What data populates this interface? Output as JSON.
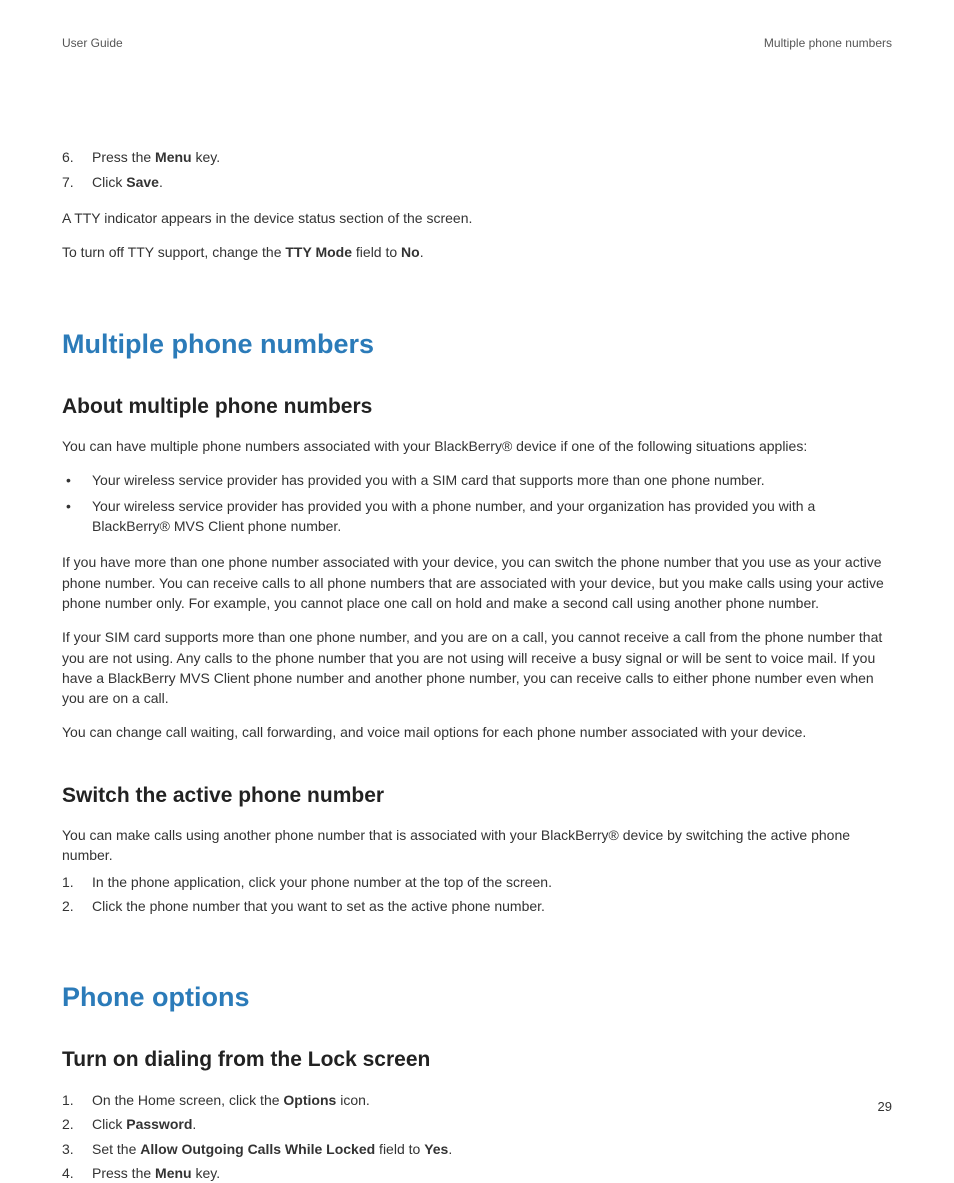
{
  "header": {
    "left": "User Guide",
    "right": "Multiple phone numbers"
  },
  "top_list": {
    "item6": {
      "pre": "Press the ",
      "bold": "Menu",
      "post": " key."
    },
    "item7": {
      "pre": "Click ",
      "bold": "Save",
      "post": "."
    }
  },
  "tty_note": "A TTY indicator appears in the device status section of the screen.",
  "tty_off": {
    "pre": "To turn off TTY support, change the ",
    "bold1": "TTY Mode",
    "mid": " field to ",
    "bold2": "No",
    "post": "."
  },
  "section1": {
    "title": "Multiple phone numbers",
    "sub1": {
      "title": "About multiple phone numbers",
      "intro": "You can have multiple phone numbers associated with your BlackBerry® device if one of the following situations applies:",
      "bullet1": "Your wireless service provider has provided you with a SIM card that supports more than one phone number.",
      "bullet2": "Your wireless service provider has provided you with a phone number, and your organization has provided you with a BlackBerry® MVS Client phone number.",
      "p1": "If you have more than one phone number associated with your device, you can switch the phone number that you use as your active phone number. You can receive calls to all phone numbers that are associated with your device, but you make calls using your active phone number only. For example, you cannot place one call on hold and make a second call using another phone number.",
      "p2": "If your SIM card supports more than one phone number, and you are on a call, you cannot receive a call from the phone number that you are not using. Any calls to the phone number that you are not using will receive a busy signal or will be sent to voice mail. If you have a BlackBerry MVS Client phone number and another phone number, you can receive calls to either phone number even when you are on a call.",
      "p3": "You can change call waiting, call forwarding, and voice mail options for each phone number associated with your device."
    },
    "sub2": {
      "title": "Switch the active phone number",
      "intro": "You can make calls using another phone number that is associated with your BlackBerry® device by switching the active phone number.",
      "step1": "In the phone application, click your phone number at the top of the screen.",
      "step2": "Click the phone number that you want to set as the active phone number."
    }
  },
  "section2": {
    "title": "Phone options",
    "sub1": {
      "title": "Turn on dialing from the Lock screen",
      "step1": {
        "pre": "On the Home screen, click the ",
        "bold": "Options",
        "post": " icon."
      },
      "step2": {
        "pre": "Click ",
        "bold": "Password",
        "post": "."
      },
      "step3": {
        "pre": "Set the ",
        "bold1": "Allow Outgoing Calls While Locked",
        "mid": " field to ",
        "bold2": "Yes",
        "post": "."
      },
      "step4": {
        "pre": "Press the ",
        "bold": "Menu",
        "post": " key."
      }
    }
  },
  "page_number": "29"
}
